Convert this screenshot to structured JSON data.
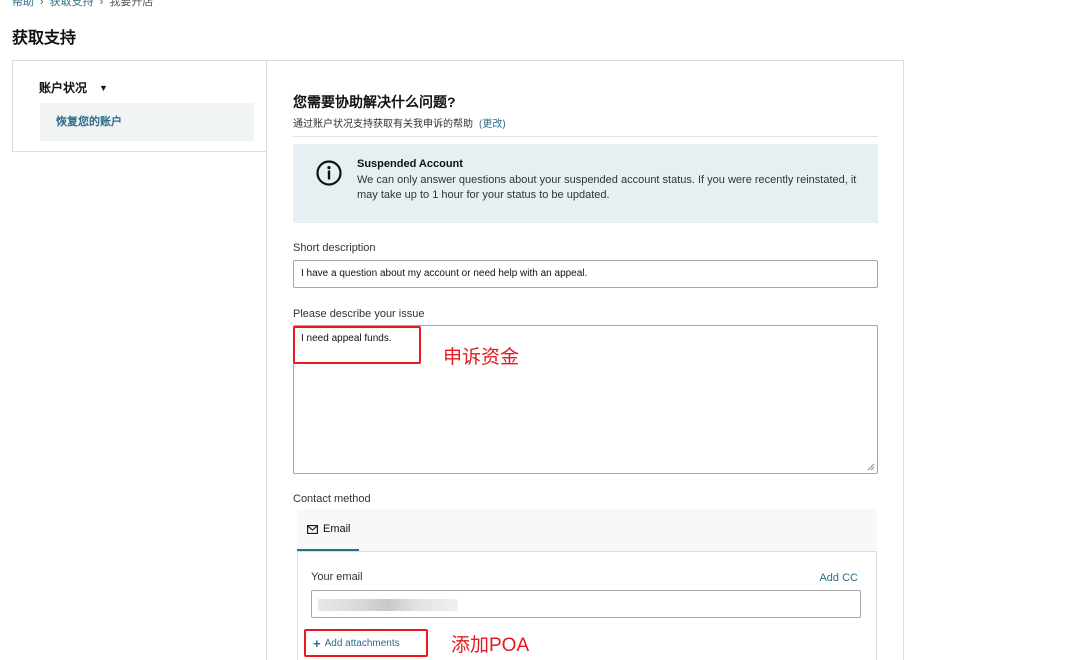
{
  "breadcrumb": {
    "items": [
      "帮助",
      "获取支持",
      "我要开店"
    ],
    "separator": "›"
  },
  "page_title": "获取支持",
  "sidebar": {
    "group_label": "账户状况",
    "group_caret": "▼",
    "items": [
      {
        "label": "恢复您的账户"
      }
    ]
  },
  "main": {
    "title": "您需要协助解决什么问题?",
    "subtitle": "通过账户状况支持获取有关我申诉的帮助",
    "change_link": "(更改)"
  },
  "alert": {
    "icon": "info-icon",
    "title": "Suspended Account",
    "body": "We can only answer questions about your suspended account status. If you were recently reinstated, it may take up to 1 hour for your status to be updated."
  },
  "form": {
    "short_description_label": "Short description",
    "short_description_value": "I have a question about my account or need help with an appeal.",
    "issue_label": "Please describe your issue",
    "issue_value": "I need appeal funds.",
    "contact_method_label": "Contact method",
    "contact_tab_label": "Email",
    "your_email_label": "Your email",
    "add_cc_label": "Add CC",
    "add_attachments_label": "Add attachments"
  },
  "annotations": {
    "appeal_note": "申诉资金",
    "poa_note": "添加POA",
    "color": "#e5191f"
  },
  "colors": {
    "link": "#2d6c8a",
    "alert_bg": "#e6f0f3",
    "nav_active_bg": "#f1f4f5"
  }
}
